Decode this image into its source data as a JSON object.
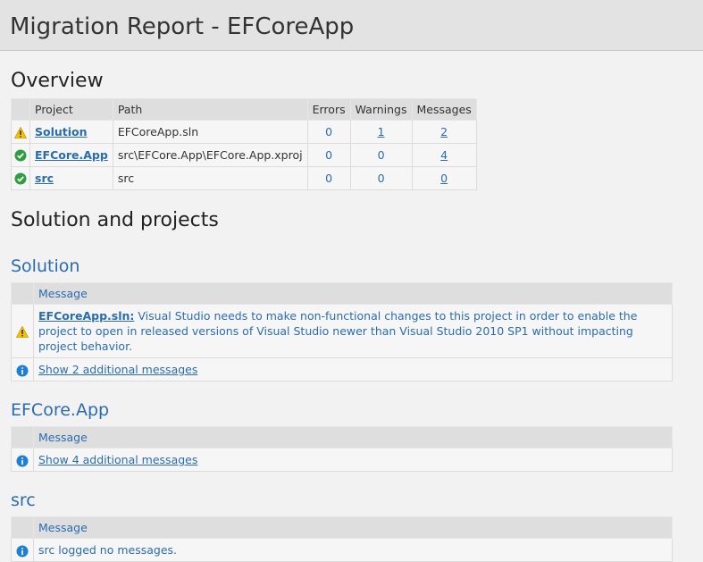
{
  "header": {
    "title": "Migration Report - EFCoreApp"
  },
  "overview": {
    "heading": "Overview",
    "columns": {
      "project": "Project",
      "path": "Path",
      "errors": "Errors",
      "warnings": "Warnings",
      "messages": "Messages"
    },
    "rows": [
      {
        "status": "warning",
        "project": "Solution",
        "path": "EFCoreApp.sln",
        "errors": "0",
        "warnings": "1",
        "messages": "2"
      },
      {
        "status": "ok",
        "project": "EFCore.App",
        "path": "src\\EFCore.App\\EFCore.App.xproj",
        "errors": "0",
        "warnings": "0",
        "messages": "4"
      },
      {
        "status": "ok",
        "project": "src",
        "path": "src",
        "errors": "0",
        "warnings": "0",
        "messages": "0"
      }
    ]
  },
  "solution_projects": {
    "heading": "Solution and projects"
  },
  "sections": {
    "solution": {
      "title": "Solution",
      "column": "Message",
      "warning_file": "EFCoreApp.sln:",
      "warning_text": "Visual Studio needs to make non-functional changes to this project in order to enable the project to open in released versions of Visual Studio newer than Visual Studio 2010 SP1 without impacting project behavior.",
      "more": "Show 2 additional messages"
    },
    "efcore": {
      "title": "EFCore.App",
      "column": "Message",
      "more": "Show 4 additional messages"
    },
    "src": {
      "title": "src",
      "column": "Message",
      "info": "src logged no messages."
    }
  },
  "colors": {
    "link": "#2b6cb0",
    "warning": "#f5c400",
    "ok": "#2e9e3e",
    "info": "#1e7fd4"
  }
}
